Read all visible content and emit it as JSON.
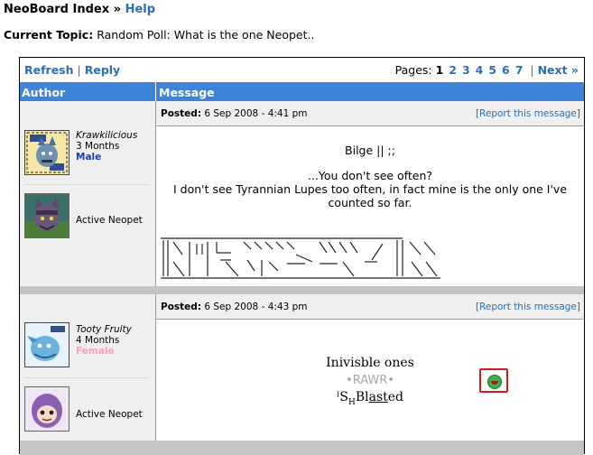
{
  "breadcrumb": {
    "index": "NeoBoard Index",
    "sep": "»",
    "help": "Help"
  },
  "topic": {
    "label": "Current Topic:",
    "title": "Random Poll: What is the one Neopet.."
  },
  "toolbar": {
    "refresh": "Refresh",
    "divider": "|",
    "reply": "Reply",
    "pages_label": "Pages:",
    "current_page": "1",
    "pages": [
      "2",
      "3",
      "4",
      "5",
      "6",
      "7"
    ],
    "next": "Next »"
  },
  "columns": {
    "author": "Author",
    "message": "Message"
  },
  "posts": [
    {
      "author": "Krawkilicious",
      "age": "3 Months",
      "gender": "Male",
      "pet_label": "Active Neopet",
      "posted_label": "Posted:",
      "posted_time": "6 Sep 2008 - 4:41 pm",
      "report": "Report this message",
      "lines": [
        "Bilge ||          ;;",
        "...You don't see often?",
        "I don't see Tyrannian Lupes too often, in fact mine is the only one I've",
        "counted so far."
      ]
    },
    {
      "author": "Tooty Fruity",
      "age": "4 Months",
      "gender": "Female",
      "pet_label": "Active Neopet",
      "posted_label": "Posted:",
      "posted_time": "6 Sep 2008 - 4:43 pm",
      "report": "Report this message",
      "line1": "Inivisble ones",
      "line2": "•RAWR•",
      "line3_prefix": "ˡS",
      "line3_sub": "H",
      "line3_b": "Bl",
      "line3_u": "ast",
      "line3_end": "ed"
    }
  ],
  "colors": {
    "link": "#2a6fb5",
    "header_bg": "#3d83d7",
    "male": "#1b3db5",
    "female": "#ff9fb6",
    "highlight": "#d21a1a"
  }
}
